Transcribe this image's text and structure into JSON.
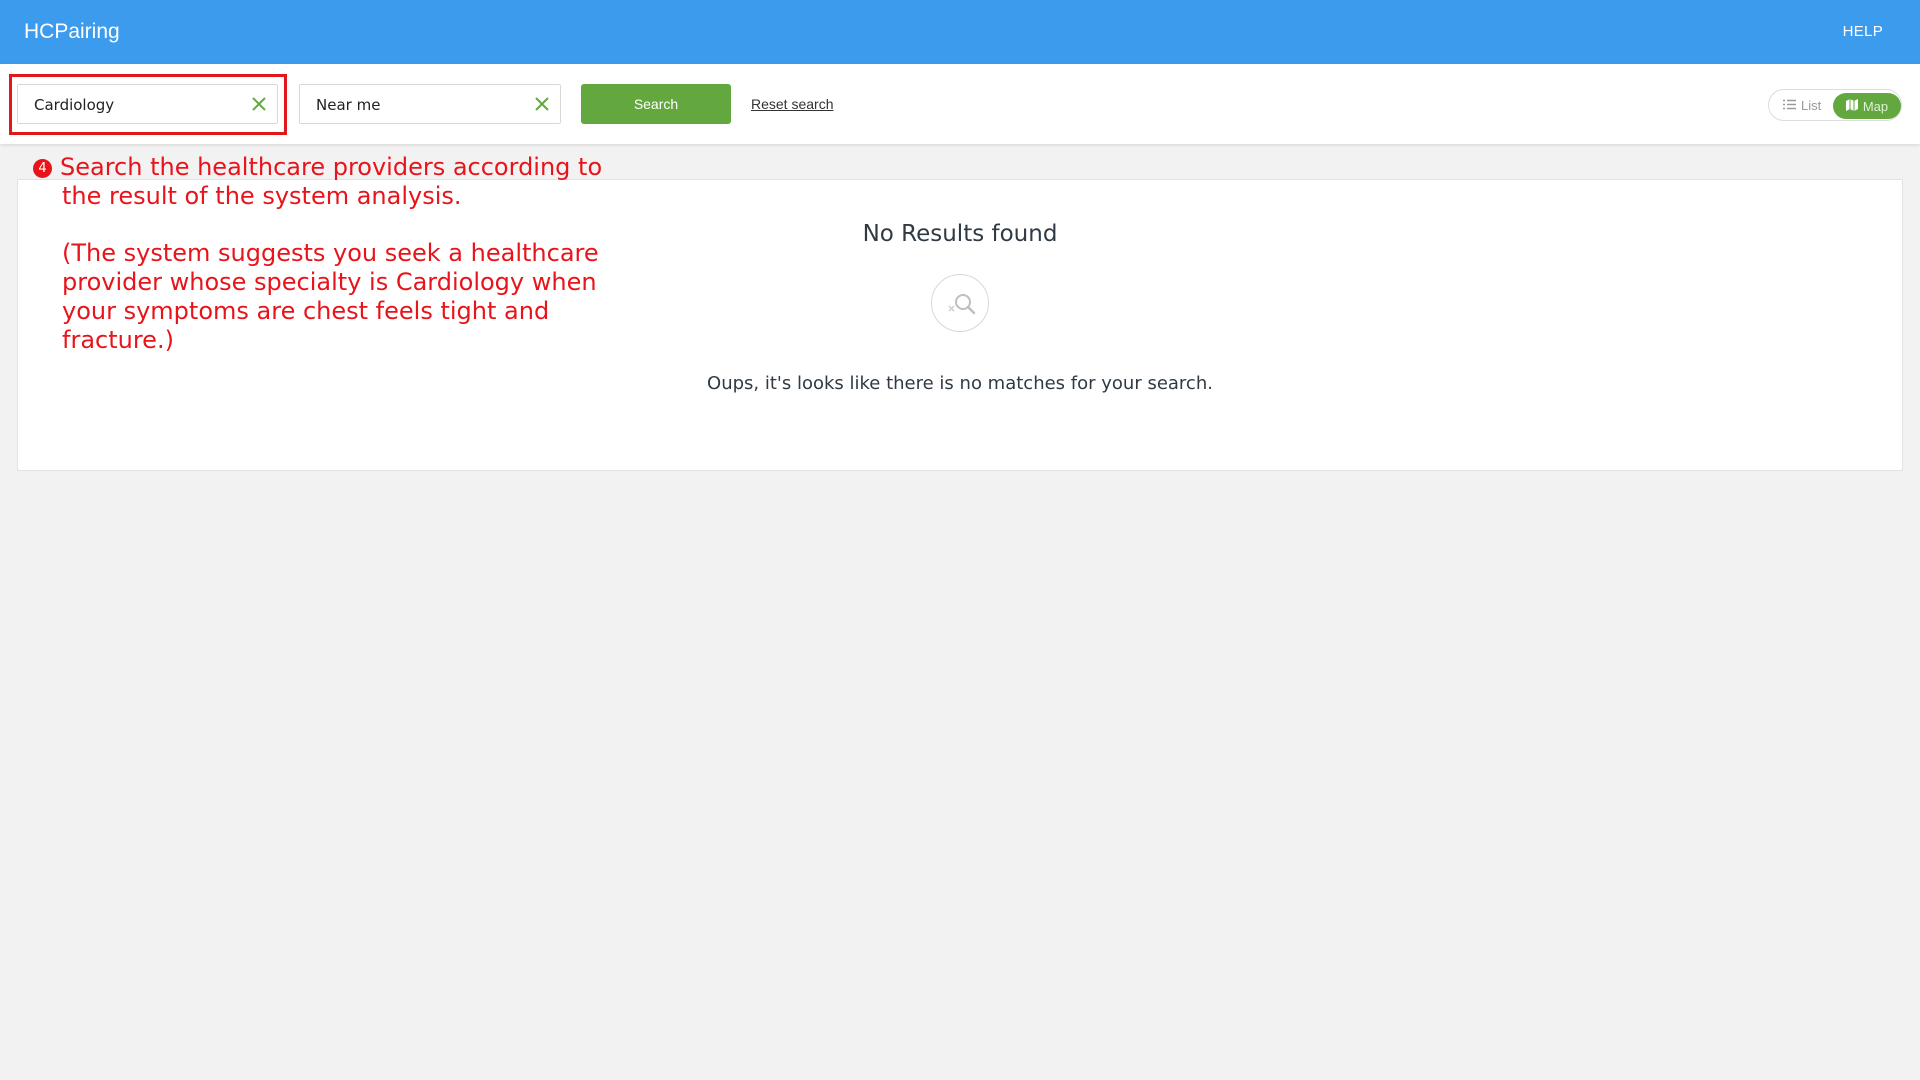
{
  "header": {
    "title": "HCPairing",
    "help_label": "HELP"
  },
  "search": {
    "specialty_value": "Cardiology",
    "location_value": "Near me",
    "search_label": "Search",
    "reset_label": "Reset search"
  },
  "view_toggle": {
    "list_label": "List",
    "map_label": "Map",
    "selected": "Map"
  },
  "annotation": {
    "step_number": "4",
    "line1": "Search the healthcare providers according to",
    "line2": "the result of the system analysis.",
    "line3": "(The system suggests you seek a healthcare",
    "line4": "provider whose specialty is Cardiology when",
    "line5": "your symptoms are chest feels tight and",
    "line6": "fracture.)"
  },
  "results": {
    "title": "No Results found",
    "message": "Oups, it's looks like there is no matches for your search."
  },
  "colors": {
    "header": "#3d9bed",
    "primary_button": "#62a83f",
    "annotation": "#e8141b",
    "background": "#f2f2f2"
  },
  "icons": {
    "clear": "close-icon",
    "list": "list-icon",
    "map": "map-icon",
    "empty": "search-empty-icon"
  }
}
